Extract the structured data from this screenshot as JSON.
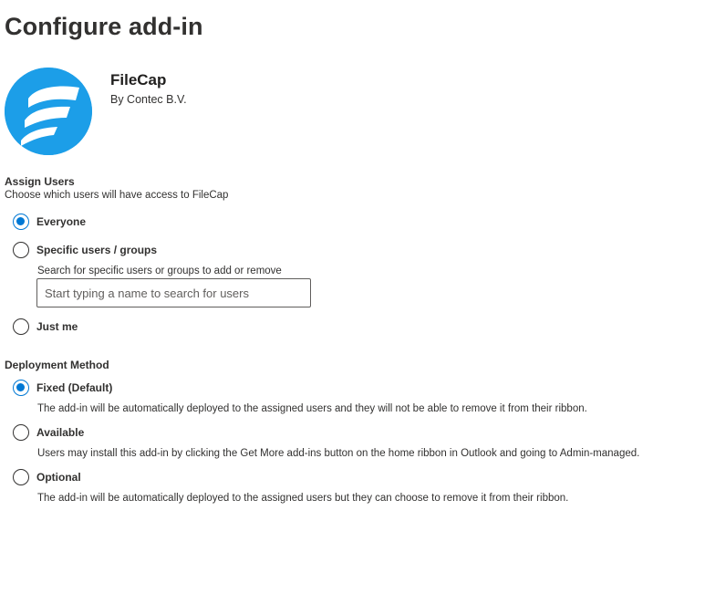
{
  "page": {
    "title": "Configure add-in"
  },
  "app": {
    "name": "FileCap",
    "publisher": "By Contec B.V.",
    "logo_color": "#1c9ee8"
  },
  "assign_users": {
    "title": "Assign Users",
    "description": "Choose which users will have access to FileCap",
    "options": [
      {
        "label": "Everyone",
        "checked": true
      },
      {
        "label": "Specific users / groups",
        "checked": false
      },
      {
        "label": "Just me",
        "checked": false
      }
    ],
    "search_hint": "Search for specific users or groups to add or remove",
    "search_placeholder": "Start typing a name to search for users"
  },
  "deployment": {
    "title": "Deployment Method",
    "options": [
      {
        "label": "Fixed (Default)",
        "checked": true,
        "description": "The add-in will be automatically deployed to the assigned users and they will not be able to remove it from their ribbon."
      },
      {
        "label": "Available",
        "checked": false,
        "description": "Users may install this add-in by clicking the Get More add-ins button on the home ribbon in Outlook and going to Admin-managed."
      },
      {
        "label": "Optional",
        "checked": false,
        "description": "The add-in will be automatically deployed to the assigned users but they can choose to remove it from their ribbon."
      }
    ]
  },
  "colors": {
    "accent": "#0078d4",
    "text": "#323130"
  }
}
